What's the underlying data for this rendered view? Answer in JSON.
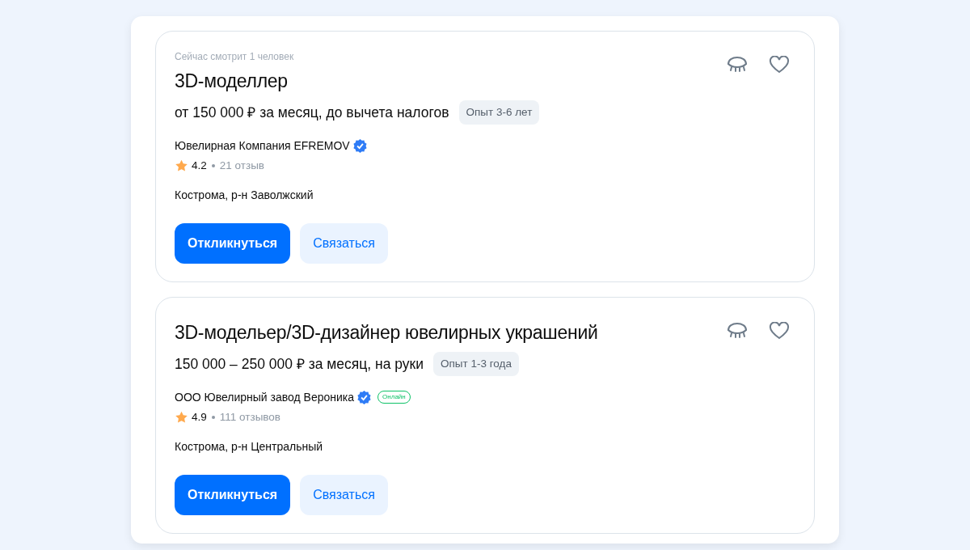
{
  "vacancies": [
    {
      "viewers": "Сейчас смотрит 1 человек",
      "title": "3D-моделлер",
      "salary": "от 150 000 ₽ за месяц, до вычета налогов",
      "experience": "Опыт 3-6 лет",
      "company": "Ювелирная Компания EFREMOV",
      "verified": true,
      "rating": "4.2",
      "reviews": "21 отзыв",
      "location": "Кострома, р-н Заволжский",
      "buttons": {
        "respond": "Откликнуться",
        "contact": "Связаться"
      }
    },
    {
      "title": "3D-модельер/3D-дизайнер ювелирных украшений",
      "salary": "150 000 – 250 000 ₽ за месяц, на руки",
      "experience": "Опыт 1-3 года",
      "company": "ООО Ювелирный завод Вероника",
      "verified": true,
      "online_badge": "Онлайн",
      "rating": "4.9",
      "reviews": "111 отзывов",
      "location": "Кострома, р-н Центральный",
      "buttons": {
        "respond": "Откликнуться",
        "contact": "Связаться"
      }
    }
  ]
}
